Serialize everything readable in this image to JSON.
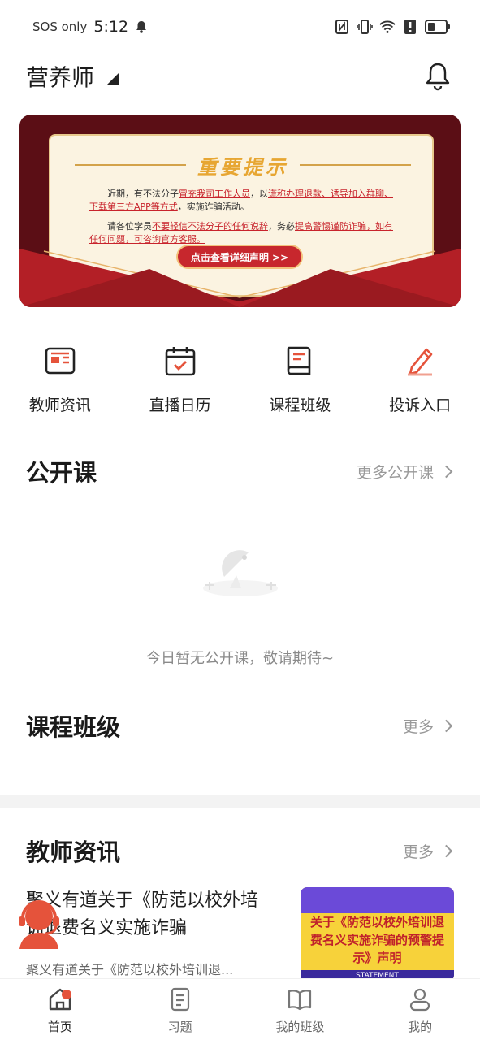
{
  "status_bar": {
    "carrier": "SOS only",
    "time": "5:12"
  },
  "header": {
    "title": "营养师"
  },
  "banner": {
    "heading": "重要提示",
    "para1_a": "近期，有不法分子",
    "para1_b": "冒充我司工作人员",
    "para1_c": "，以",
    "para1_d": "谎称办理退款、诱导加入群聊、下载第三方APP等方式",
    "para1_e": "，实施诈骗活动。",
    "para2_a": "请各位学员",
    "para2_b": "不要轻信不法分子的任何说辞",
    "para2_c": "，务必",
    "para2_d": "提高警惕谨防诈骗，如有任何问题，可咨询官方客服。",
    "cta": "点击查看详细声明 >>"
  },
  "quick_nav": [
    {
      "label": "教师资讯",
      "icon": "news-icon"
    },
    {
      "label": "直播日历",
      "icon": "calendar-icon"
    },
    {
      "label": "课程班级",
      "icon": "book-icon"
    },
    {
      "label": "投诉入口",
      "icon": "pencil-icon"
    }
  ],
  "open_course": {
    "title": "公开课",
    "more": "更多公开课",
    "empty_text": "今日暂无公开课，敬请期待~"
  },
  "course_class": {
    "title": "课程班级",
    "more": "更多"
  },
  "teacher_news": {
    "title": "教师资讯",
    "more": "更多",
    "items": [
      {
        "title": "聚义有道关于《防范以校外培训退费名义实施诈骗",
        "summary": "聚义有道关于《防范以校外培训退...",
        "thumb_text": "关于《防范以校外培训退费名义实施诈骗的预警提示》声明",
        "thumb_badge": "STATEMENT"
      }
    ]
  },
  "tab_bar": [
    {
      "label": "首页",
      "icon": "home-icon"
    },
    {
      "label": "习题",
      "icon": "exercise-icon"
    },
    {
      "label": "我的班级",
      "icon": "class-book-icon"
    },
    {
      "label": "我的",
      "icon": "profile-icon"
    }
  ],
  "colors": {
    "accent": "#e5533b",
    "banner_bg": "#5b0e15",
    "heading_gold": "#e7a632",
    "warning_red": "#c8232c"
  }
}
